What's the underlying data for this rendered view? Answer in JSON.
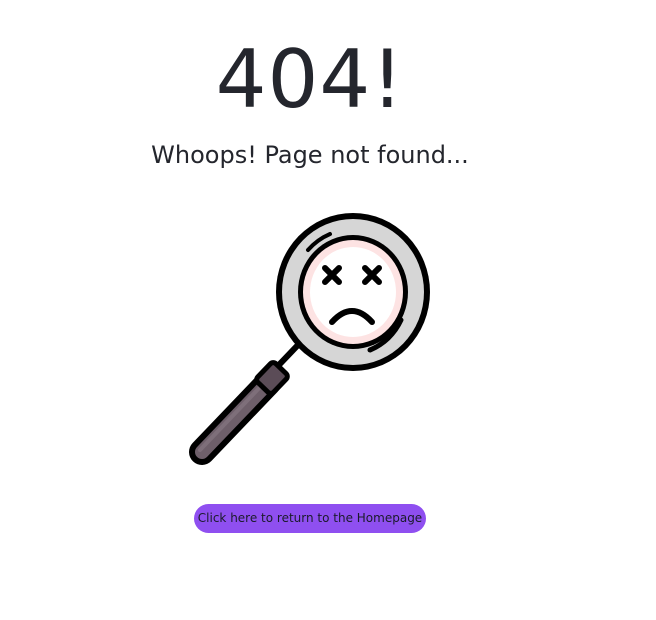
{
  "error": {
    "code_heading": "404!",
    "message": "Whoops! Page not found..."
  },
  "illustration": {
    "icon": "magnifying-glass-sad-face-icon"
  },
  "actions": {
    "home_button_label": "Click here to return to the Homepage"
  },
  "colors": {
    "text": "#24262d",
    "button_bg": "#8f4ff0",
    "lens_ring": "#d6d6d6",
    "lens_tint": "#fde3e3",
    "handle": "#6e5f6a"
  }
}
